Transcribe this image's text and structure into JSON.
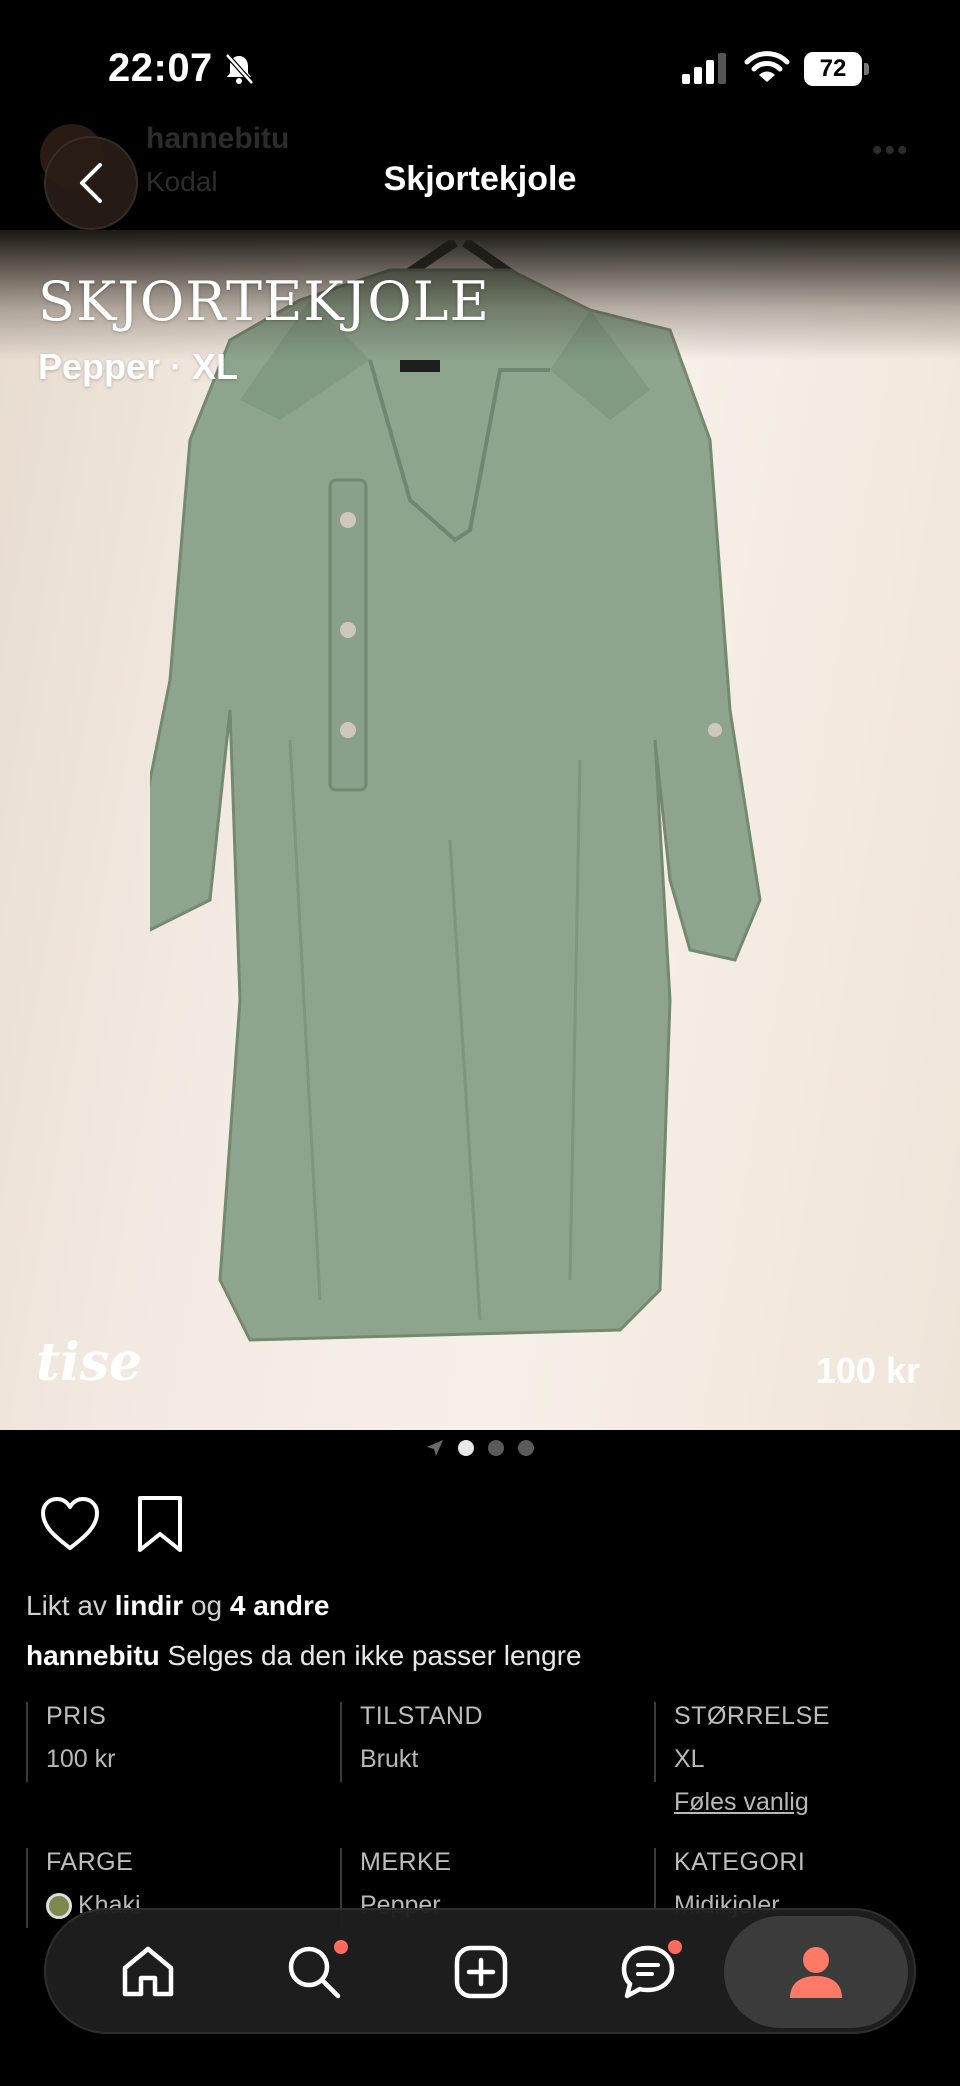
{
  "status_bar": {
    "time": "22:07",
    "battery": "72",
    "icons": [
      "bell-muted-icon",
      "signal-icon",
      "wifi-icon",
      "battery-icon"
    ]
  },
  "header": {
    "title": "Skjortekjole",
    "ghost_username": "hannebitu",
    "ghost_location": "Kodal",
    "icons": [
      "back-chevron-icon",
      "more-icon"
    ]
  },
  "listing": {
    "image_title": "SKJORTEKJOLE",
    "image_subtitle": "Pepper · XL",
    "watermark": "tise",
    "image_price": "100 kr",
    "images_count": 3,
    "current_image": 1
  },
  "social": {
    "liked_by_prefix": "Likt av",
    "liked_by_user": "lindir",
    "liked_by_and": "og",
    "liked_by_others": "4 andre",
    "seller": "hannebitu",
    "description": "Selges da den ikke passer lengre"
  },
  "attributes": {
    "price_label": "PRIS",
    "price_value": "100 kr",
    "condition_label": "TILSTAND",
    "condition_value": "Brukt",
    "size_label": "STØRRELSE",
    "size_value": "XL",
    "size_link": "Føles vanlig",
    "color_label": "FARGE",
    "color_value": "Khaki",
    "color_swatch": "#7a8a4e",
    "brand_label": "MERKE",
    "brand_value": "Pepper",
    "category_label": "KATEGORI",
    "category_value": "Midikjoler"
  },
  "bottom_nav": {
    "items": [
      "home-icon",
      "search-icon",
      "add-icon",
      "chat-icon",
      "profile-icon"
    ],
    "accent": "#ff6a5c"
  }
}
